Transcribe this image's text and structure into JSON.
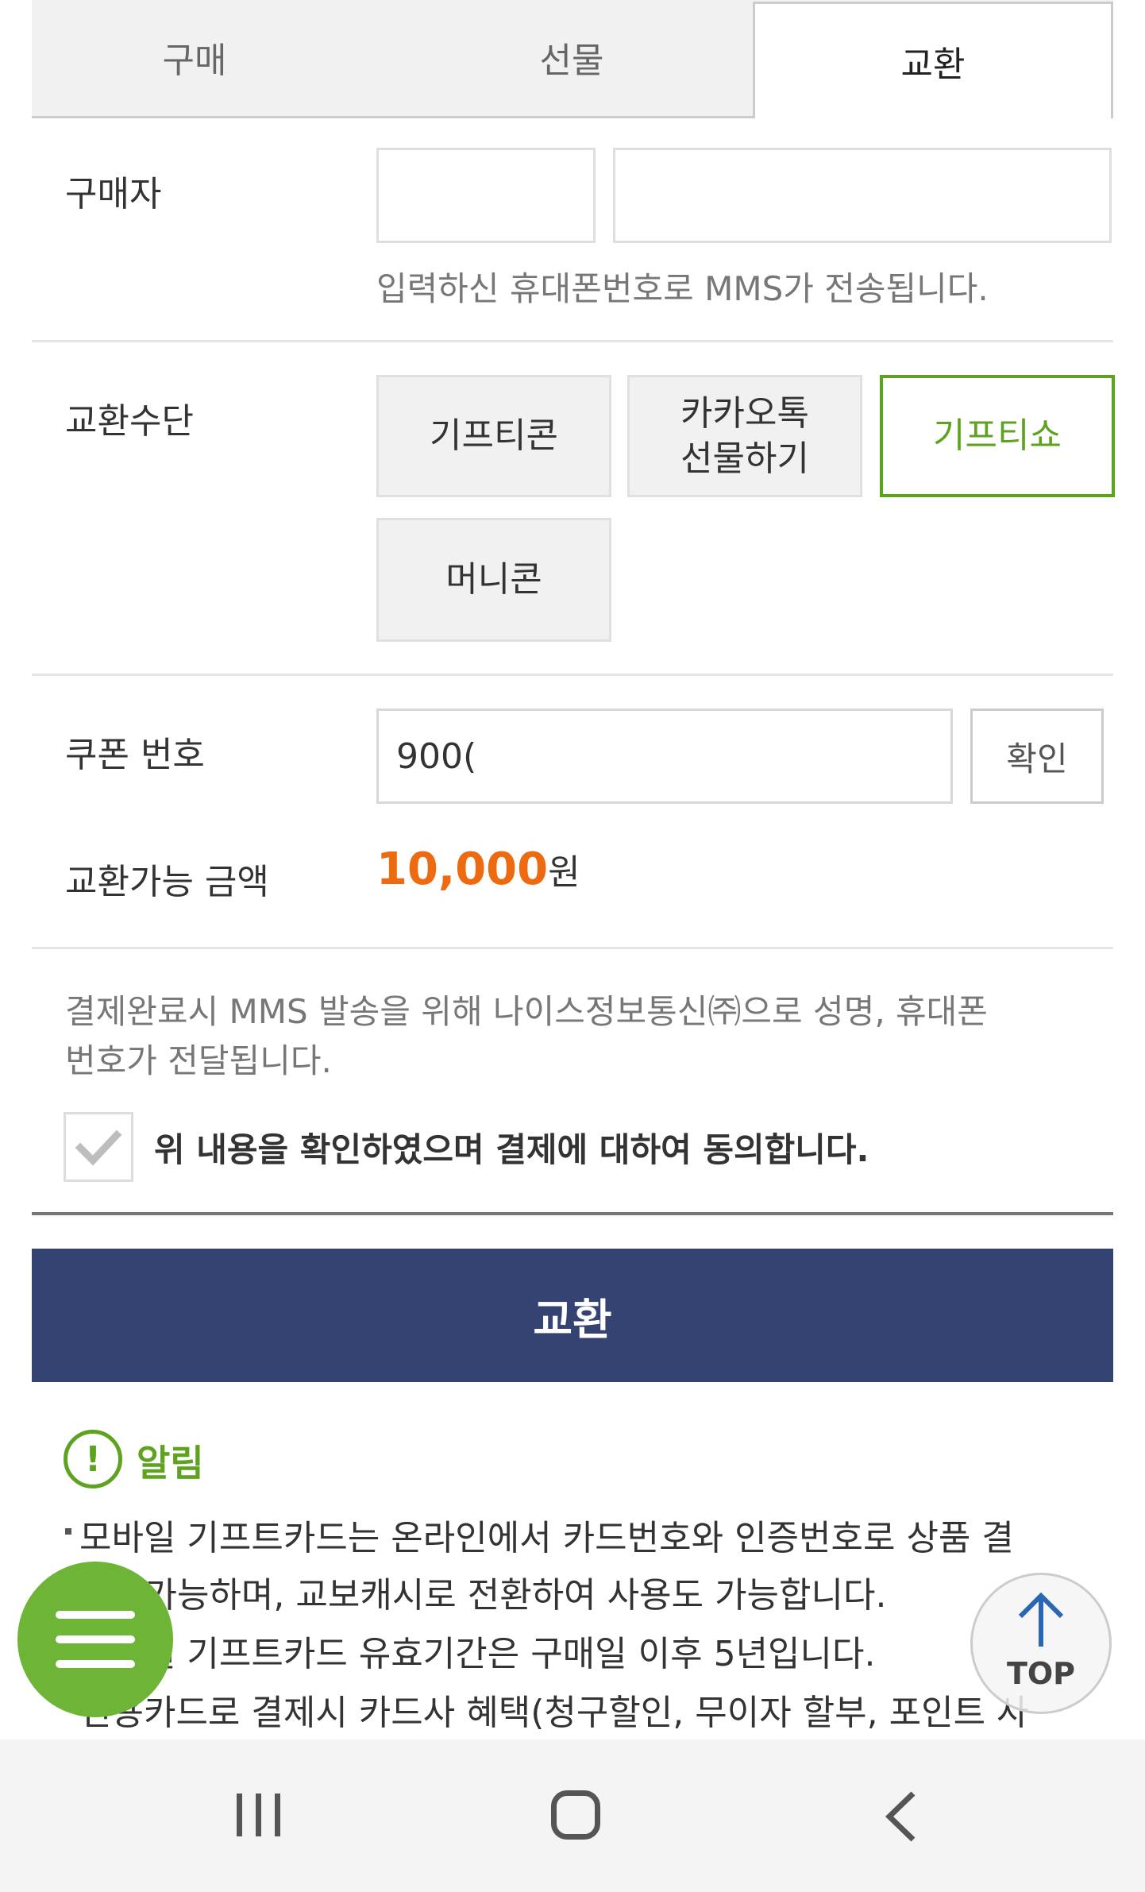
{
  "tabs": [
    {
      "label": "구매",
      "active": false
    },
    {
      "label": "선물",
      "active": false
    },
    {
      "label": "교환",
      "active": true
    }
  ],
  "buyer": {
    "label": "구매자",
    "name_value": "",
    "phone_value": "",
    "hint": "입력하신 휴대폰번호로 MMS가 전송됩니다."
  },
  "exchange_method": {
    "label": "교환수단",
    "options": [
      "기프티콘",
      "카카오톡\n선물하기",
      "기프티쇼",
      "머니콘"
    ],
    "selected": "기프티쇼"
  },
  "coupon": {
    "label": "쿠폰 번호",
    "value": "900(",
    "confirm_label": "확인"
  },
  "amount": {
    "label": "교환가능 금액",
    "value": "10,000",
    "unit": "원"
  },
  "consent": {
    "notice": "결제완료시 MMS 발송을 위해 나이스정보통신㈜으로 성명, 휴대폰",
    "notice2": "번호가 전달됩니다.",
    "checkbox_label": "위 내용을 확인하였으며 결제에 대하여 동의합니다.",
    "checked": true
  },
  "submit_label": "교환",
  "notice_section": {
    "title": "알림",
    "lines": [
      "모바일 기프트카드는 온라인에서 카드번호와 인증번호로 상품 결",
      "제 가능하며, 교보캐시로 전환하여 사용도 가능합니다.",
      "모바일 기프트카드 유효기간은 구매일 이후 5년입니다.",
      "신용카드로 결제시 카드사 혜택(청구할인, 무이자 할부, 포인트 사"
    ]
  },
  "top_button_label": "TOP",
  "colors": {
    "accent_green": "#5ea320",
    "amount_orange": "#ee6a10",
    "submit_navy": "#344372"
  }
}
